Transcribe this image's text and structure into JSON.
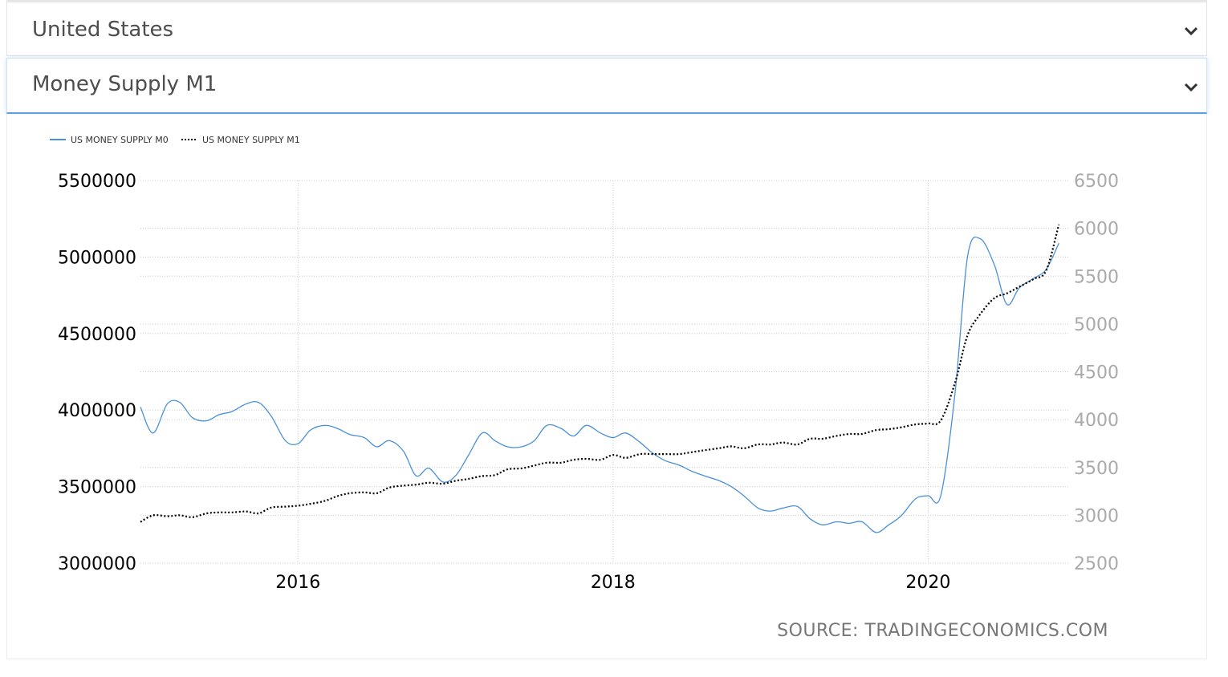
{
  "selectors": {
    "country": "United States",
    "indicator": "Money Supply M1"
  },
  "source": "SOURCE: TRADINGECONOMICS.COM",
  "colors": {
    "m0": "#4a90d9",
    "m1": "#000000",
    "grid": "#cccccc",
    "left_axis": "#000000",
    "right_axis": "#aaaaaa"
  },
  "chart_data": {
    "type": "line",
    "title": "",
    "legend": [
      "US MONEY SUPPLY M0",
      "US MONEY SUPPLY M1"
    ],
    "legend_position": "top-left",
    "grid": true,
    "x_ticks": [
      "2016",
      "2018",
      "2020"
    ],
    "xlim": [
      2015.0,
      2020.9
    ],
    "y_left": {
      "ticks": [
        "5500000",
        "5000000",
        "4500000",
        "4000000",
        "3500000",
        "3000000"
      ],
      "ylim": [
        3000000,
        5500000
      ]
    },
    "y_right": {
      "ticks": [
        "6500",
        "6000",
        "5500",
        "5000",
        "4500",
        "4000",
        "3500",
        "3000",
        "2500"
      ],
      "ylim": [
        2500,
        6500
      ]
    },
    "series": [
      {
        "name": "US MONEY SUPPLY M0",
        "axis": "left",
        "x": [
          2015.0,
          2015.08,
          2015.17,
          2015.25,
          2015.33,
          2015.42,
          2015.5,
          2015.58,
          2015.67,
          2015.75,
          2015.83,
          2015.92,
          2016.0,
          2016.08,
          2016.17,
          2016.25,
          2016.33,
          2016.42,
          2016.5,
          2016.58,
          2016.67,
          2016.75,
          2016.83,
          2016.92,
          2017.0,
          2017.08,
          2017.17,
          2017.25,
          2017.33,
          2017.42,
          2017.5,
          2017.58,
          2017.67,
          2017.75,
          2017.83,
          2017.92,
          2018.0,
          2018.08,
          2018.17,
          2018.25,
          2018.33,
          2018.42,
          2018.5,
          2018.58,
          2018.67,
          2018.75,
          2018.83,
          2018.92,
          2019.0,
          2019.08,
          2019.17,
          2019.25,
          2019.33,
          2019.42,
          2019.5,
          2019.58,
          2019.67,
          2019.75,
          2019.83,
          2019.92,
          2020.0,
          2020.08,
          2020.17,
          2020.25,
          2020.33,
          2020.42,
          2020.5,
          2020.58,
          2020.67,
          2020.75,
          2020.83
        ],
        "values": [
          4020000,
          3850000,
          4040000,
          4050000,
          3950000,
          3930000,
          3970000,
          3990000,
          4040000,
          4050000,
          3960000,
          3800000,
          3780000,
          3870000,
          3900000,
          3880000,
          3840000,
          3820000,
          3760000,
          3800000,
          3730000,
          3570000,
          3620000,
          3530000,
          3570000,
          3700000,
          3850000,
          3800000,
          3760000,
          3760000,
          3800000,
          3900000,
          3880000,
          3830000,
          3900000,
          3850000,
          3820000,
          3850000,
          3790000,
          3720000,
          3670000,
          3640000,
          3600000,
          3570000,
          3540000,
          3500000,
          3440000,
          3360000,
          3340000,
          3360000,
          3370000,
          3290000,
          3250000,
          3270000,
          3260000,
          3270000,
          3200000,
          3250000,
          3310000,
          3420000,
          3440000,
          3440000,
          4100000,
          5000000,
          5120000,
          4950000,
          4690000,
          4800000,
          4860000,
          4920000,
          5090000
        ]
      },
      {
        "name": "US MONEY SUPPLY M1",
        "axis": "right",
        "x": [
          2015.0,
          2015.08,
          2015.17,
          2015.25,
          2015.33,
          2015.42,
          2015.5,
          2015.58,
          2015.67,
          2015.75,
          2015.83,
          2015.92,
          2016.0,
          2016.08,
          2016.17,
          2016.25,
          2016.33,
          2016.42,
          2016.5,
          2016.58,
          2016.67,
          2016.75,
          2016.83,
          2016.92,
          2017.0,
          2017.08,
          2017.17,
          2017.25,
          2017.33,
          2017.42,
          2017.5,
          2017.58,
          2017.67,
          2017.75,
          2017.83,
          2017.92,
          2018.0,
          2018.08,
          2018.17,
          2018.25,
          2018.33,
          2018.42,
          2018.5,
          2018.58,
          2018.67,
          2018.75,
          2018.83,
          2018.92,
          2019.0,
          2019.08,
          2019.17,
          2019.25,
          2019.33,
          2019.42,
          2019.5,
          2019.58,
          2019.67,
          2019.75,
          2019.83,
          2019.92,
          2020.0,
          2020.08,
          2020.17,
          2020.25,
          2020.33,
          2020.42,
          2020.5,
          2020.58,
          2020.67,
          2020.75,
          2020.83
        ],
        "values": [
          2930,
          3000,
          2990,
          3000,
          2980,
          3020,
          3030,
          3030,
          3040,
          3020,
          3080,
          3090,
          3100,
          3120,
          3150,
          3200,
          3230,
          3240,
          3230,
          3290,
          3310,
          3320,
          3340,
          3330,
          3360,
          3380,
          3410,
          3420,
          3480,
          3490,
          3520,
          3550,
          3550,
          3580,
          3590,
          3580,
          3630,
          3600,
          3640,
          3640,
          3640,
          3640,
          3660,
          3680,
          3700,
          3720,
          3700,
          3740,
          3740,
          3760,
          3740,
          3800,
          3800,
          3830,
          3850,
          3850,
          3890,
          3900,
          3920,
          3950,
          3960,
          3990,
          4380,
          4880,
          5100,
          5270,
          5320,
          5390,
          5470,
          5560,
          6040
        ]
      }
    ]
  }
}
